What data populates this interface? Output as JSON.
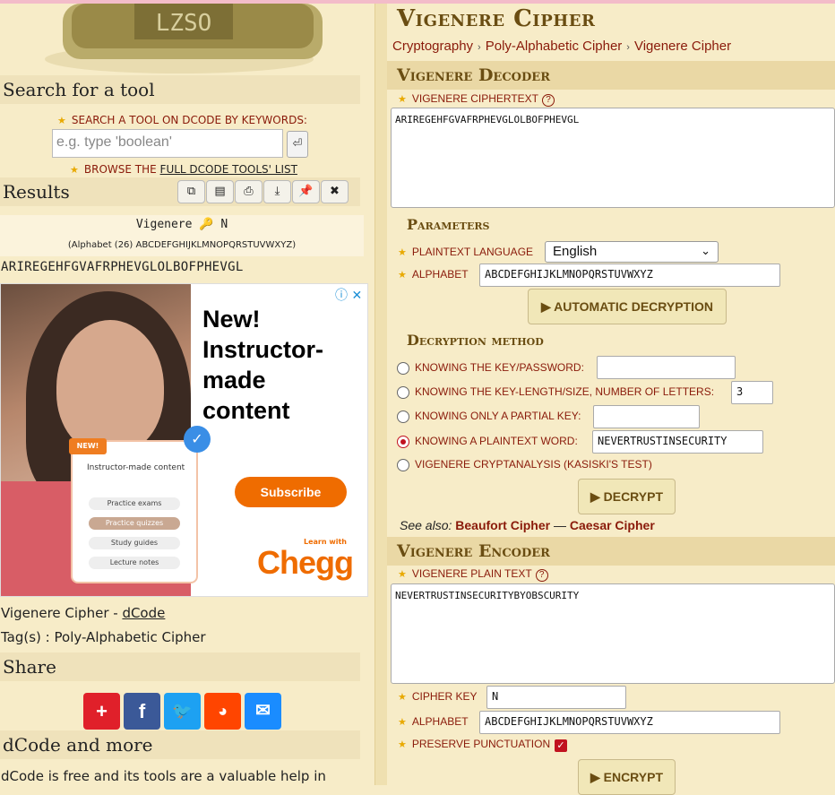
{
  "left": {
    "search": {
      "heading": "Search for a tool",
      "label": "SEARCH A TOOL ON DCODE BY KEYWORDS:",
      "placeholder": "e.g. type 'boolean'",
      "browse_prefix": "BROWSE THE",
      "browse_link": "FULL DCODE TOOLS' LIST"
    },
    "results": {
      "heading": "Results",
      "buttons": [
        "copy-icon",
        "clipboard-icon",
        "print-icon",
        "download-icon",
        "pin-icon",
        "close-icon"
      ],
      "title_text": "Vigenere",
      "title_key": "N",
      "alphabet_line": "(Alphabet (26) ABCDEFGHIJKLMNOPQRSTUVWXYZ)",
      "output": "ARIREGEHFGVAFRPHEVGLOLBOFPHEVGL"
    },
    "ad": {
      "headline_1": "New!",
      "headline_2": "Instructor-",
      "headline_3": "made",
      "headline_4": "content",
      "card_badge": "NEW!",
      "card_title": "Instructor-made content",
      "card_items": [
        "Practice exams",
        "Practice quizzes",
        "Study guides",
        "Lecture notes"
      ],
      "cta": "Subscribe",
      "brand_tag": "Learn with",
      "brand": "Chegg"
    },
    "page_name": "Vigenere Cipher - ",
    "page_link": "dCode",
    "tags": "Tag(s) : Poly-Alphabetic Cipher",
    "share_heading": "Share",
    "share_icons": [
      "plus-share-icon",
      "facebook-icon",
      "twitter-icon",
      "reddit-icon",
      "email-icon"
    ],
    "more_heading": "dCode and more",
    "more_text": "dCode is free and its tools are a valuable help in"
  },
  "right": {
    "title": "Vigenere Cipher",
    "breadcrumbs": [
      "Cryptography",
      "Poly-Alphabetic Cipher",
      "Vigenere Cipher"
    ],
    "decoder": {
      "heading": "Vigenere Decoder",
      "ciphertext_label": "VIGENERE CIPHERTEXT",
      "ciphertext": "ARIREGEHFGVAFRPHEVGLOLBOFPHEVGL",
      "params_heading": "Parameters",
      "lang_label": "PLAINTEXT LANGUAGE",
      "lang_value": "English",
      "alphabet_label": "ALPHABET",
      "alphabet_value": "ABCDEFGHIJKLMNOPQRSTUVWXYZ",
      "auto_button": "AUTOMATIC DECRYPTION",
      "method_heading": "Decryption method",
      "methods": [
        {
          "label": "KNOWING THE KEY/PASSWORD:",
          "value": ""
        },
        {
          "label": "KNOWING THE KEY-LENGTH/SIZE, NUMBER OF LETTERS:",
          "value": "3"
        },
        {
          "label": "KNOWING ONLY A PARTIAL KEY:",
          "value": ""
        },
        {
          "label": "KNOWING A PLAINTEXT WORD:",
          "value": "NEVERTRUSTINSECURITY"
        },
        {
          "label": "VIGENERE CRYPTANALYSIS (KASISKI'S TEST)"
        }
      ],
      "selected_method": 3,
      "decrypt_button": "DECRYPT",
      "see_also_label": "See also:",
      "see_also_1": "Beaufort Cipher",
      "see_also_sep": "—",
      "see_also_2": "Caesar Cipher"
    },
    "encoder": {
      "heading": "Vigenere Encoder",
      "plaintext_label": "VIGENERE PLAIN TEXT",
      "plaintext": "NEVERTRUSTINSECURITYBYOBSCURITY",
      "key_label": "CIPHER KEY",
      "key_value": "N",
      "alphabet_label": "ALPHABET",
      "alphabet_value": "ABCDEFGHIJKLMNOPQRSTUVWXYZ",
      "punct_label": "PRESERVE PUNCTUATION",
      "punct_checked": true,
      "encrypt_button": "ENCRYPT"
    }
  },
  "colors": {
    "page_bg": "#f7ecc8",
    "heading_brown": "#6a4d12",
    "link_red": "#8a1a0a",
    "section_bg": "#ead8a5"
  }
}
